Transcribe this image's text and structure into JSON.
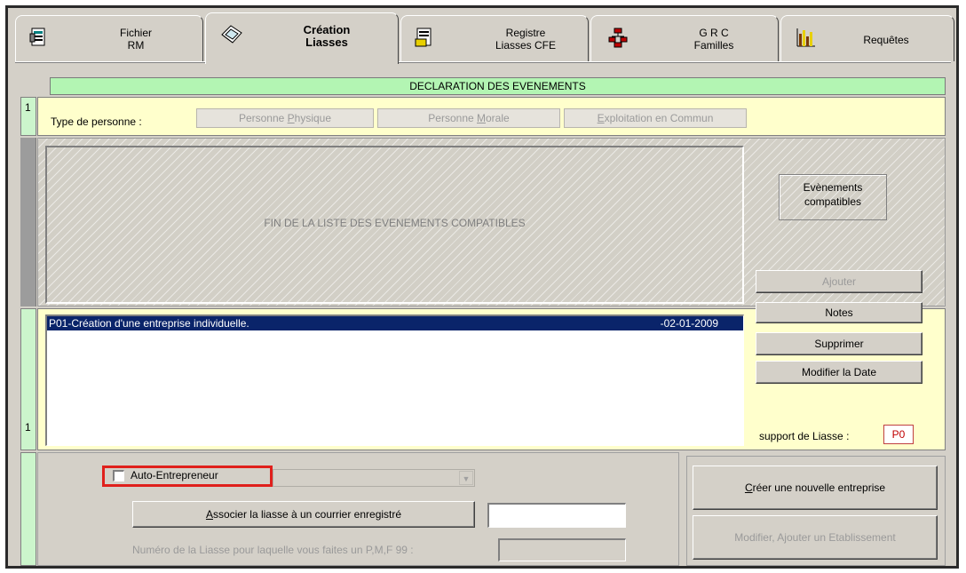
{
  "tabs": [
    {
      "line1": "Fichier",
      "line2": "RM",
      "icon": "form-icon"
    },
    {
      "line1": "Création",
      "line2": "Liasses",
      "icon": "folder-open-icon",
      "active": true
    },
    {
      "line1": "Registre",
      "line2": "Liasses CFE",
      "icon": "registry-icon"
    },
    {
      "line1": "G R C",
      "line2": "Familles",
      "icon": "org-chart-icon"
    },
    {
      "line1": "Requêtes",
      "line2": "",
      "icon": "bar-chart-icon"
    }
  ],
  "header": {
    "title": "DECLARATION DES EVENEMENTS"
  },
  "type_row": {
    "number": "1",
    "label": "Type de personne :",
    "options": [
      {
        "pre": "Personne ",
        "ul": "P",
        "post": "hysique"
      },
      {
        "pre": "Personne ",
        "ul": "M",
        "post": "orale"
      },
      {
        "pre": "",
        "ul": "E",
        "post": "xploitation en Commun"
      }
    ]
  },
  "compatible": {
    "end_message": "FIN DE LA LISTE DES EVENEMENTS COMPATIBLES",
    "side_label_line1": "Evènements",
    "side_label_line2": "compatibles",
    "add_button": "Ajouter"
  },
  "events": {
    "number": "1",
    "selected_item": {
      "label": "P01-Création d'une entreprise individuelle.",
      "date": "-02-01-2009"
    },
    "notes_button": "Notes",
    "delete_button": "Supprimer",
    "modify_date_button": "Modifier la Date",
    "support_label": "support de Liasse :",
    "support_value": "P0"
  },
  "bottom": {
    "auto_entrepreneur_label": "Auto-Entrepreneur",
    "auto_entrepreneur_checked": false,
    "associate_button": {
      "ul": "A",
      "post": "ssocier la liasse à un courrier enregistré"
    },
    "courrier_value": "",
    "liasse_number_label": "Numéro de la Liasse pour laquelle vous faites un P,M,F 99 :",
    "liasse_number_value": "",
    "create_button": {
      "ul": "C",
      "post": "réer une nouvelle entreprise"
    },
    "modify_button": "Modifier, Ajouter un Etablissement"
  },
  "colors": {
    "highlight_border": "#e0201c",
    "selection": "#0a246a",
    "header_green": "#b3f5b3",
    "panel_yellow": "#ffffcc"
  }
}
